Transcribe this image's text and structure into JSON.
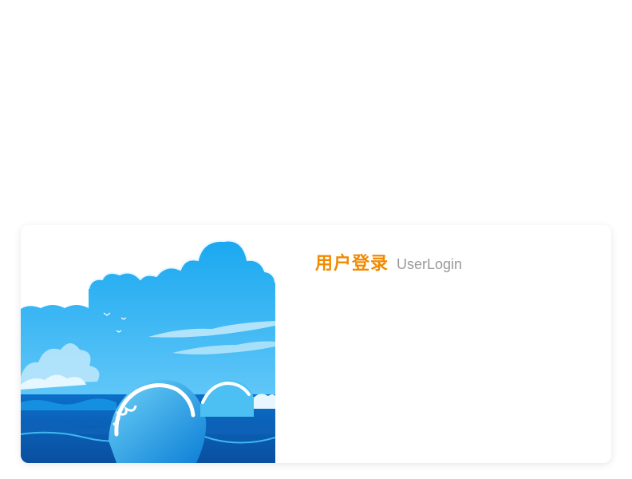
{
  "login": {
    "title_cn": "用户登录",
    "title_en": "UserLogin"
  },
  "illustration": {
    "subject": "ocean-waves-sky"
  },
  "colors": {
    "accent": "#f28a00",
    "subtitle": "#999999",
    "sky": "#29b6f6",
    "ocean": "#0a7fd1"
  }
}
